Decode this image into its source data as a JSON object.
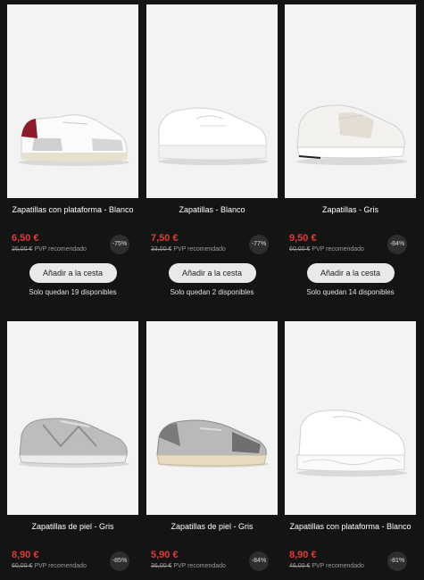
{
  "products": [
    {
      "title": "Zapatillas con plataforma - Blanco",
      "price": "6,50 €",
      "old_price": "26,00 €",
      "pvp_note": "PVP recomendado",
      "discount": "-75%",
      "cta": "Añadir a la cesta",
      "stock": "Solo quedan 19 disponibles"
    },
    {
      "title": "Zapatillas - Blanco",
      "price": "7,50 €",
      "old_price": "33,00 €",
      "pvp_note": "PVP recomendado",
      "discount": "-77%",
      "cta": "Añadir a la cesta",
      "stock": "Solo quedan 2 disponibles"
    },
    {
      "title": "Zapatillas - Gris",
      "price": "9,50 €",
      "old_price": "60,00 €",
      "pvp_note": "PVP recomendado",
      "discount": "-84%",
      "cta": "Añadir a la cesta",
      "stock": "Solo quedan 14 disponibles"
    },
    {
      "title": "Zapatillas de piel - Gris",
      "price": "8,90 €",
      "old_price": "60,00 €",
      "pvp_note": "PVP recomendado",
      "discount": "-85%"
    },
    {
      "title": "Zapatillas de piel - Gris",
      "price": "5,90 €",
      "old_price": "36,00 €",
      "pvp_note": "PVP recomendado",
      "discount": "-84%"
    },
    {
      "title": "Zapatillas con plataforma - Blanco",
      "price": "8,90 €",
      "old_price": "46,00 €",
      "pvp_note": "PVP recomendado",
      "discount": "-81%"
    }
  ],
  "colors": {
    "background": "#141414",
    "price": "#e53935",
    "button": "#e9e9e9"
  }
}
